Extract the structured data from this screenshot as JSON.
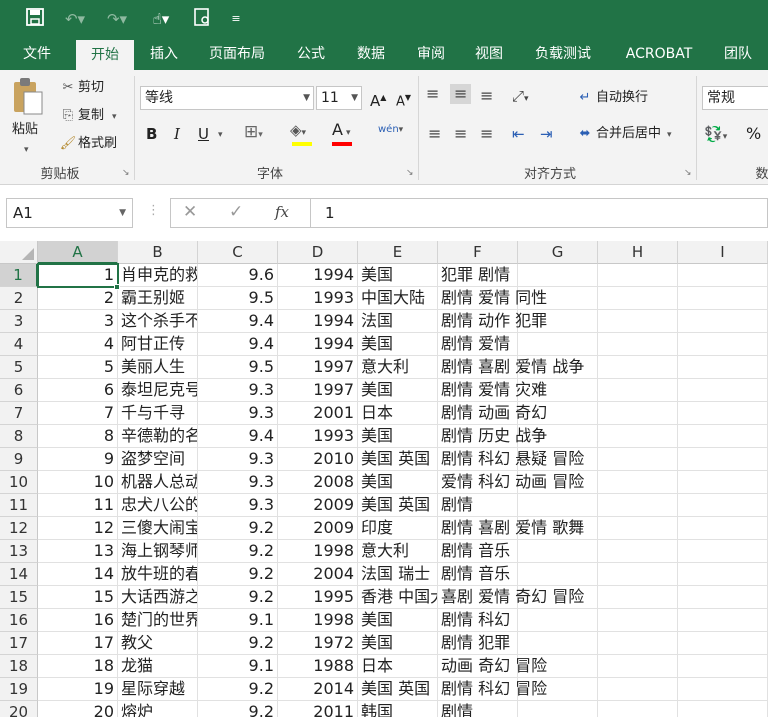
{
  "qat": {
    "save_icon": "save-icon",
    "undo_icon": "undo-icon",
    "redo_icon": "redo-icon",
    "touch_icon": "touch-mode-icon",
    "preview_icon": "print-preview-icon",
    "customize_icon": "customize-icon"
  },
  "tabs": [
    "文件",
    "开始",
    "插入",
    "页面布局",
    "公式",
    "数据",
    "审阅",
    "视图",
    "负载测试",
    "ACROBAT",
    "团队"
  ],
  "active_tab": "开始",
  "ribbon": {
    "clipboard": {
      "paste": "粘贴",
      "cut": "剪切",
      "copy": "复制",
      "format_painter": "格式刷",
      "group_label": "剪贴板"
    },
    "font": {
      "font_name": "等线",
      "font_size": "11",
      "grow": "A",
      "shrink": "A",
      "bold": "B",
      "italic": "I",
      "underline": "U",
      "fill_color": "#ffff00",
      "font_color": "#ff0000",
      "font_color_letter": "A",
      "phonetic": "wén",
      "group_label": "字体"
    },
    "alignment": {
      "wrap_text": "自动换行",
      "merge_center": "合并后居中",
      "group_label": "对齐方式"
    },
    "number": {
      "format": "常规",
      "percent": "%",
      "group_label_partial": "数"
    }
  },
  "formula_bar": {
    "name_box": "A1",
    "cancel": "✕",
    "enter": "✓",
    "fx": "fx",
    "formula": "1"
  },
  "columns": [
    "A",
    "B",
    "C",
    "D",
    "E",
    "F",
    "G",
    "H",
    "I"
  ],
  "selected_cell": "A1",
  "rows": [
    {
      "n": "1",
      "a": "1",
      "b": "肖申克的救赎",
      "c": "9.6",
      "d": "1994",
      "e": "美国",
      "f": "犯罪 剧情"
    },
    {
      "n": "2",
      "a": "2",
      "b": "霸王别姬",
      "c": "9.5",
      "d": "1993",
      "e": "中国大陆",
      "f": "剧情 爱情 同性"
    },
    {
      "n": "3",
      "a": "3",
      "b": "这个杀手不太冷",
      "c": "9.4",
      "d": "1994",
      "e": "法国",
      "f": "剧情 动作 犯罪"
    },
    {
      "n": "4",
      "a": "4",
      "b": "阿甘正传",
      "c": "9.4",
      "d": "1994",
      "e": "美国",
      "f": "剧情 爱情"
    },
    {
      "n": "5",
      "a": "5",
      "b": "美丽人生",
      "c": "9.5",
      "d": "1997",
      "e": "意大利",
      "f": "剧情 喜剧 爱情 战争"
    },
    {
      "n": "6",
      "a": "6",
      "b": "泰坦尼克号",
      "c": "9.3",
      "d": "1997",
      "e": "美国",
      "f": "剧情 爱情 灾难"
    },
    {
      "n": "7",
      "a": "7",
      "b": "千与千寻",
      "c": "9.3",
      "d": "2001",
      "e": "日本",
      "f": "剧情 动画 奇幻"
    },
    {
      "n": "8",
      "a": "8",
      "b": "辛德勒的名单",
      "c": "9.4",
      "d": "1993",
      "e": "美国",
      "f": "剧情 历史 战争"
    },
    {
      "n": "9",
      "a": "9",
      "b": "盗梦空间",
      "c": "9.3",
      "d": "2010",
      "e": "美国 英国",
      "f": "剧情 科幻 悬疑 冒险"
    },
    {
      "n": "10",
      "a": "10",
      "b": "机器人总动员",
      "c": "9.3",
      "d": "2008",
      "e": "美国",
      "f": "爱情 科幻 动画 冒险"
    },
    {
      "n": "11",
      "a": "11",
      "b": "忠犬八公的故事",
      "c": "9.3",
      "d": "2009",
      "e": "美国 英国",
      "f": "剧情"
    },
    {
      "n": "12",
      "a": "12",
      "b": "三傻大闹宝莱坞",
      "c": "9.2",
      "d": "2009",
      "e": "印度",
      "f": "剧情 喜剧 爱情 歌舞"
    },
    {
      "n": "13",
      "a": "13",
      "b": "海上钢琴师",
      "c": "9.2",
      "d": "1998",
      "e": "意大利",
      "f": "剧情 音乐"
    },
    {
      "n": "14",
      "a": "14",
      "b": "放牛班的春天",
      "c": "9.2",
      "d": "2004",
      "e": "法国 瑞士",
      "f": "剧情 音乐"
    },
    {
      "n": "15",
      "a": "15",
      "b": "大话西游之大圣娶亲",
      "c": "9.2",
      "d": "1995",
      "e": "香港 中国大陆",
      "f": "喜剧 爱情 奇幻 冒险"
    },
    {
      "n": "16",
      "a": "16",
      "b": "楚门的世界",
      "c": "9.1",
      "d": "1998",
      "e": "美国",
      "f": "剧情 科幻"
    },
    {
      "n": "17",
      "a": "17",
      "b": "教父",
      "c": "9.2",
      "d": "1972",
      "e": "美国",
      "f": "剧情 犯罪"
    },
    {
      "n": "18",
      "a": "18",
      "b": "龙猫",
      "c": "9.1",
      "d": "1988",
      "e": "日本",
      "f": "动画 奇幻 冒险"
    },
    {
      "n": "19",
      "a": "19",
      "b": "星际穿越",
      "c": "9.2",
      "d": "2014",
      "e": "美国 英国",
      "f": "剧情 科幻 冒险"
    },
    {
      "n": "20",
      "a": "20",
      "b": "熔炉",
      "c": "9.2",
      "d": "2011",
      "e": "韩国",
      "f": "剧情"
    }
  ]
}
